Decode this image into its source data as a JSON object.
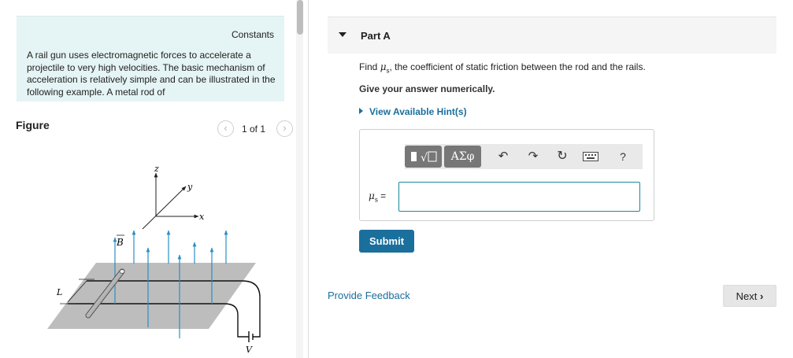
{
  "constants": {
    "link_label": "Constants",
    "text": "A rail gun uses electromagnetic forces to accelerate a projectile to very high velocities. The basic mechanism of acceleration is relatively simple and can be illustrated in the following example. A metal rod of"
  },
  "figure": {
    "title": "Figure",
    "pager": "1 of 1",
    "prev_icon": "chevron-left-icon",
    "next_icon": "chevron-right-icon",
    "labels": {
      "z": "z",
      "y": "y",
      "x": "x",
      "b": "B",
      "l": "L",
      "v": "V"
    }
  },
  "part": {
    "title": "Part A",
    "question": "Find μ, the coefficient of static friction between the rod and the rails.",
    "question_symbol": "μ",
    "question_sub": "s",
    "question_rest": ", the coefficient of static friction between the rod and the rails.",
    "question_prefix": "Find ",
    "instruction": "Give your answer numerically.",
    "hint": "View Available Hint(s)"
  },
  "toolbar": {
    "templates_label": "√",
    "greek_label": "ΑΣφ",
    "undo_icon": "undo-icon",
    "redo_icon": "redo-icon",
    "reset_icon": "reset-icon",
    "keyboard_icon": "keyboard-icon",
    "help_label": "?"
  },
  "answer": {
    "label_symbol": "μ",
    "label_sub": "s",
    "label_eq": " =",
    "value": ""
  },
  "buttons": {
    "submit": "Submit",
    "feedback": "Provide Feedback",
    "next": "Next"
  },
  "colors": {
    "accent": "#1a6f9c",
    "constants_bg": "#e5f4f4",
    "field_arrows": "#2a8fc4"
  }
}
